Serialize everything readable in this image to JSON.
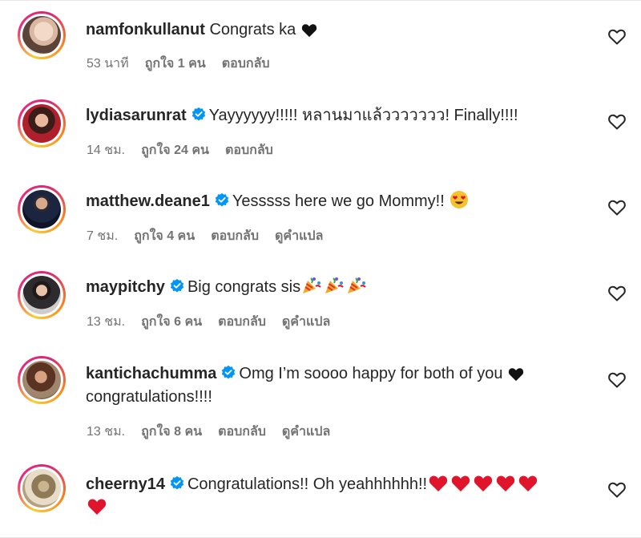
{
  "comments": [
    {
      "username": "namfonkullanut",
      "verified": false,
      "text": "Congrats ka",
      "time": "53 นาที",
      "likes": "ถูกใจ 1 คน",
      "reply": "ตอบกลับ",
      "translate": ""
    },
    {
      "username": "lydiasarunrat",
      "verified": true,
      "text": "Yayyyyyy!!!!! หลานมาแล้ววววววว! Finally!!!!",
      "time": "14 ชม.",
      "likes": "ถูกใจ 24 คน",
      "reply": "ตอบกลับ",
      "translate": ""
    },
    {
      "username": "matthew.deane1",
      "verified": true,
      "text": "Yesssss here we go Mommy!!",
      "time": "7 ชม.",
      "likes": "ถูกใจ 4 คน",
      "reply": "ตอบกลับ",
      "translate": "ดูคำแปล"
    },
    {
      "username": "maypitchy",
      "verified": true,
      "text": "Big congrats sis",
      "time": "13 ชม.",
      "likes": "ถูกใจ 6 คน",
      "reply": "ตอบกลับ",
      "translate": "ดูคำแปล"
    },
    {
      "username": "kantichachumma",
      "verified": true,
      "text": "Omg I’m soooo happy for both of you",
      "text2": "congratulations!!!!",
      "time": "13 ชม.",
      "likes": "ถูกใจ 8 คน",
      "reply": "ตอบกลับ",
      "translate": "ดูคำแปล"
    },
    {
      "username": "cheerny14",
      "verified": true,
      "text": "Congratulations!! Oh yeahhhhhh!!",
      "time": "",
      "likes": "",
      "reply": "",
      "translate": ""
    }
  ],
  "icons": {
    "like": "heart-outline-icon",
    "verified": "verified-badge-icon",
    "black_heart": "black-heart-emoji",
    "red_heart": "red-heart-emoji",
    "party": "party-popper-emoji",
    "heart_eyes": "heart-eyes-emoji"
  },
  "colors": {
    "verified": "#0095f6",
    "meta": "#737373",
    "red_heart": "#e0142b"
  }
}
